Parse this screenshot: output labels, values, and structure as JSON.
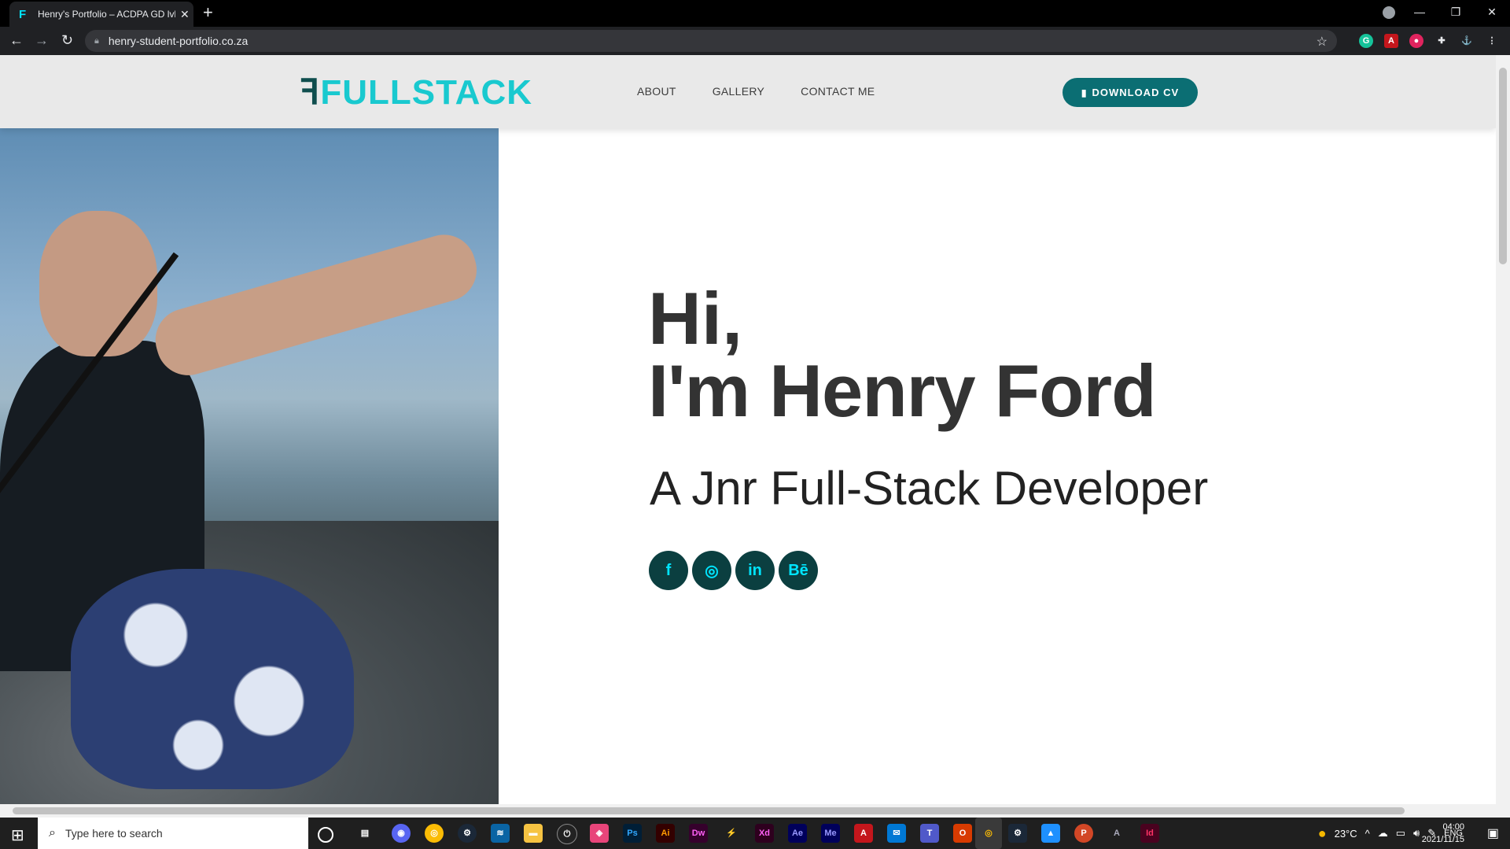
{
  "browser": {
    "tab_title": "Henry's Portfolio – ACDPA GD lvl",
    "tab_favicon": "F",
    "url": "henry-student-portfolio.co.za",
    "new_tab": "+",
    "tab_close": "✕",
    "nav_back": "←",
    "nav_forward": "→",
    "reload": "↻",
    "bookmark_star": "☆",
    "window_controls": [
      "—",
      "❐",
      "✕"
    ]
  },
  "site": {
    "logo_mark": "ꟻ",
    "logo_text": "FULLSTACK",
    "nav": [
      "ABOUT",
      "GALLERY",
      "CONTACT ME"
    ],
    "cv_button": "DOWNLOAD CV",
    "hero": {
      "greeting": "Hi,",
      "name": "I'm Henry Ford",
      "role": "A Jnr Full-Stack Developer"
    },
    "socials": [
      {
        "name": "facebook-icon",
        "glyph": "f"
      },
      {
        "name": "instagram-icon",
        "glyph": "◎"
      },
      {
        "name": "linkedin-icon",
        "glyph": "in"
      },
      {
        "name": "behance-icon",
        "glyph": "Bē"
      }
    ],
    "colors": {
      "accent": "#19c9cf",
      "button": "#0b6e73",
      "social_bg": "#0b3f40",
      "header_bg": "#e9e9e9"
    }
  },
  "taskbar": {
    "search_placeholder": "Type here to search",
    "weather": "23°C",
    "language": "ENG",
    "time": "04:00",
    "date": "2021/11/15",
    "apps": [
      "Ps",
      "Ai",
      "Dw",
      "Xd",
      "Ae",
      "Me",
      "Id"
    ]
  }
}
